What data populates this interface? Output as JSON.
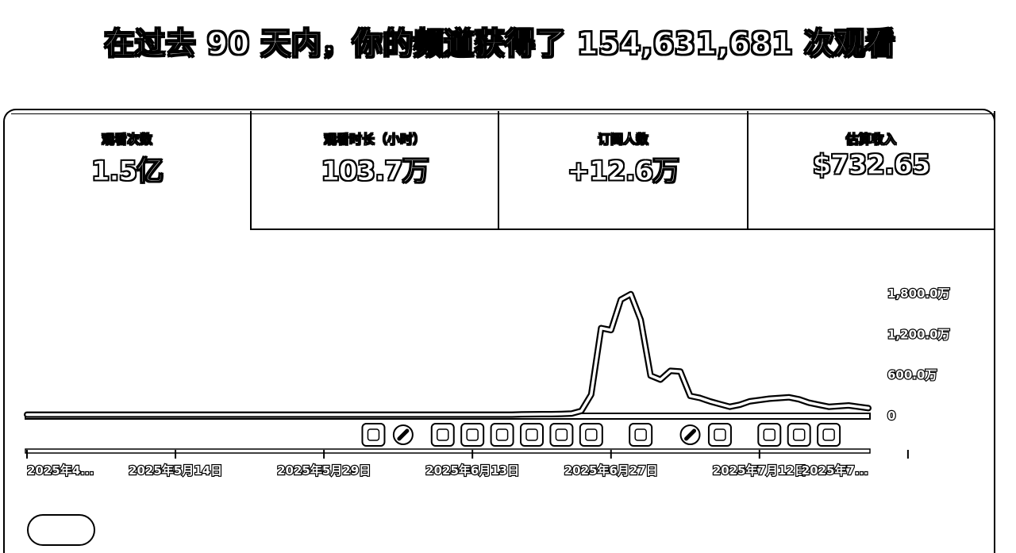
{
  "headline": "在过去 90 天内，你的频道获得了 154,631,681 次观看",
  "metrics": [
    {
      "label": "观看次数",
      "value": "1.5亿"
    },
    {
      "label": "观看时长（小时）",
      "value": "103.7万"
    },
    {
      "label": "订阅人数",
      "value": "+12.6万"
    },
    {
      "label": "估算收入",
      "value": "$732.65"
    }
  ],
  "chart_data": {
    "type": "line",
    "title": "",
    "xlabel": "",
    "ylabel": "",
    "ylim": [
      0,
      1800
    ],
    "y_ticks": [
      {
        "value": 1800,
        "label": "1,800.0万"
      },
      {
        "value": 1200,
        "label": "1,200.0万"
      },
      {
        "value": 600,
        "label": "600.0万"
      },
      {
        "value": 0,
        "label": "0"
      }
    ],
    "x_date_labels": [
      {
        "day": 0,
        "label": "2025年4..."
      },
      {
        "day": 15,
        "label": "2025年5月14日"
      },
      {
        "day": 30,
        "label": "2025年5月29日"
      },
      {
        "day": 45,
        "label": "2025年6月13日"
      },
      {
        "day": 59,
        "label": "2025年6月27日"
      },
      {
        "day": 74,
        "label": "2025年7月12日"
      },
      {
        "day": 89,
        "label": "2025年7..."
      }
    ],
    "series": [
      {
        "values": [
          5,
          5,
          5,
          5,
          5,
          5,
          5,
          5,
          5,
          5,
          5,
          5,
          5,
          5,
          5,
          5,
          5,
          5,
          5,
          5,
          5,
          5,
          5,
          5,
          5,
          5,
          5,
          5,
          5,
          5,
          5,
          5,
          5,
          5,
          5,
          5,
          5,
          5,
          5,
          5,
          5,
          5,
          5,
          5,
          5,
          5,
          5,
          5,
          5,
          5,
          8,
          10,
          12,
          12,
          15,
          20,
          60,
          300,
          1280,
          1250,
          1700,
          1780,
          1400,
          580,
          520,
          650,
          640,
          280,
          250,
          200,
          160,
          120,
          150,
          200,
          220,
          240,
          250,
          260,
          230,
          180,
          150,
          120,
          130,
          140,
          120,
          100
        ]
      }
    ],
    "markers": [
      {
        "day": 35,
        "icon": "video"
      },
      {
        "day": 38,
        "icon": "shorts"
      },
      {
        "day": 42,
        "icon": "video"
      },
      {
        "day": 45,
        "icon": "video"
      },
      {
        "day": 48,
        "icon": "video"
      },
      {
        "day": 51,
        "icon": "live"
      },
      {
        "day": 54,
        "icon": "live"
      },
      {
        "day": 57,
        "icon": "video"
      },
      {
        "day": 62,
        "icon": "video"
      },
      {
        "day": 67,
        "icon": "shorts"
      },
      {
        "day": 70,
        "icon": "video"
      },
      {
        "day": 75,
        "icon": "video"
      },
      {
        "day": 78,
        "icon": "video"
      },
      {
        "day": 81,
        "icon": "live"
      }
    ]
  }
}
